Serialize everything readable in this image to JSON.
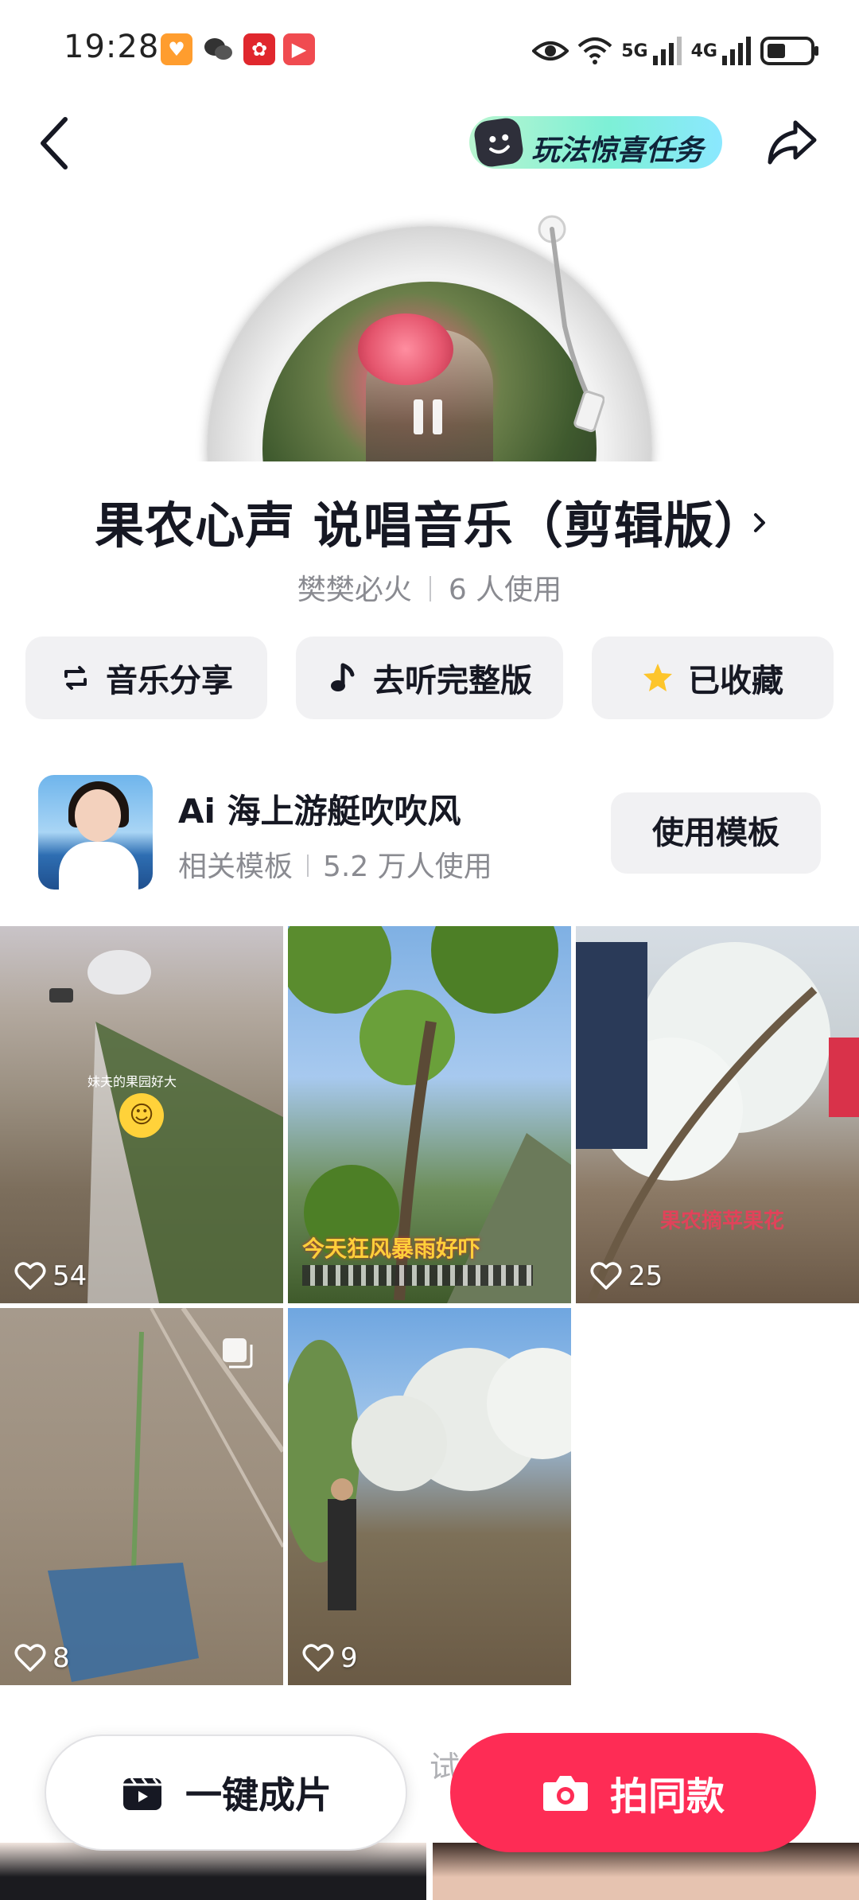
{
  "status_bar": {
    "time": "19:28",
    "net_5g": "5G",
    "net_4g": "4G",
    "app_icons": [
      "heart-app-icon",
      "wechat-icon",
      "weibo-icon",
      "video-app-icon"
    ]
  },
  "header": {
    "task_label": "玩法惊喜任务"
  },
  "song": {
    "title": "果农心声 说唱音乐（剪辑版）",
    "author": "樊樊必火",
    "usage": "6 人使用"
  },
  "actions": {
    "share_label": "音乐分享",
    "full_label": "去听完整版",
    "favorited_label": "已收藏"
  },
  "template": {
    "name": "Ai 海上游艇吹吹风",
    "tag": "相关模板",
    "usage": "5.2 万人使用",
    "use_button": "使用模板"
  },
  "videos": [
    {
      "likes": "54",
      "caption": "妹夫的果园好大"
    },
    {
      "likes": "",
      "caption": "今天狂风暴雨好吓"
    },
    {
      "likes": "25",
      "caption": "果农摘苹果花"
    },
    {
      "likes": "8",
      "caption": ""
    },
    {
      "likes": "9",
      "caption": ""
    }
  ],
  "bottom": {
    "one_click_label": "一键成片",
    "shoot_label": "拍同款",
    "behind_text": "试"
  },
  "colors": {
    "primary_red": "#fe2c55",
    "button_gray": "#f1f1f3",
    "text_primary": "#161823",
    "text_secondary": "#8a8b91",
    "star_yellow": "#fdc52b"
  }
}
